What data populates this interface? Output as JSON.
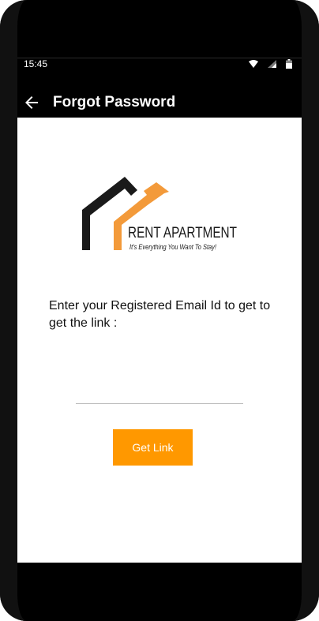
{
  "status_bar": {
    "time": "15:45",
    "icons": [
      "wifi-icon",
      "signal-icon",
      "battery-icon"
    ]
  },
  "app_bar": {
    "title": "Forgot Password",
    "back_icon": "arrow-left-icon"
  },
  "logo": {
    "name": "RENT APARTMENT",
    "tagline": "It's Everything You Want To Stay!",
    "colors": {
      "dark": "#1a1a1a",
      "accent": "#f39a3a"
    }
  },
  "form": {
    "instructions": "Enter your Registered Email Id to get to get the link :",
    "email_value": "",
    "email_placeholder": "",
    "submit_label": "Get Link"
  },
  "theme": {
    "accent": "#ff9800",
    "app_bar_bg": "#000000",
    "content_bg": "#ffffff"
  }
}
